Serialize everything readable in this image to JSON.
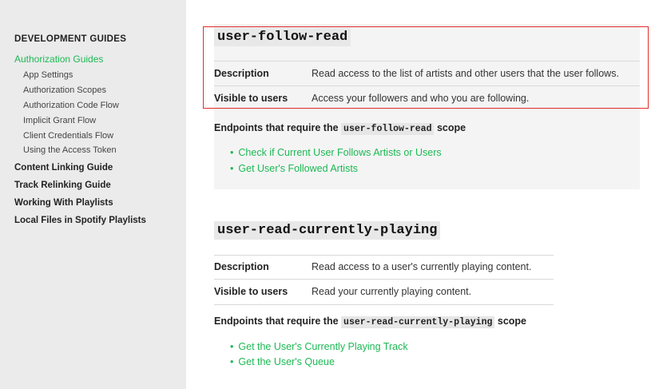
{
  "sidebar": {
    "heading": "DEVELOPMENT GUIDES",
    "active_item": "Authorization Guides",
    "sub_items": [
      "App Settings",
      "Authorization Scopes",
      "Authorization Code Flow",
      "Implicit Grant Flow",
      "Client Credentials Flow",
      "Using the Access Token"
    ],
    "main_items": [
      "Content Linking Guide",
      "Track Relinking Guide",
      "Working With Playlists",
      "Local Files in Spotify Playlists"
    ]
  },
  "scopes": [
    {
      "name": "user-follow-read",
      "description_label": "Description",
      "description": "Read access to the list of artists and other users that the user follows.",
      "visible_label": "Visible to users",
      "visible": "Access your followers and who you are following.",
      "endpoints_prefix": "Endpoints that require the",
      "endpoints_code": "user-follow-read",
      "endpoints_suffix": "scope",
      "endpoints": [
        "Check if Current User Follows Artists or Users",
        "Get User's Followed Artists"
      ]
    },
    {
      "name": "user-read-currently-playing",
      "description_label": "Description",
      "description": "Read access to a user's currently playing content.",
      "visible_label": "Visible to users",
      "visible": "Read your currently playing content.",
      "endpoints_prefix": "Endpoints that require the",
      "endpoints_code": "user-read-currently-playing",
      "endpoints_suffix": "scope",
      "endpoints": [
        "Get the User's Currently Playing Track",
        "Get the User's Queue"
      ]
    }
  ],
  "colors": {
    "accent": "#1db954",
    "highlight_border": "#e22b2b",
    "sidebar_bg": "#ebebeb"
  }
}
